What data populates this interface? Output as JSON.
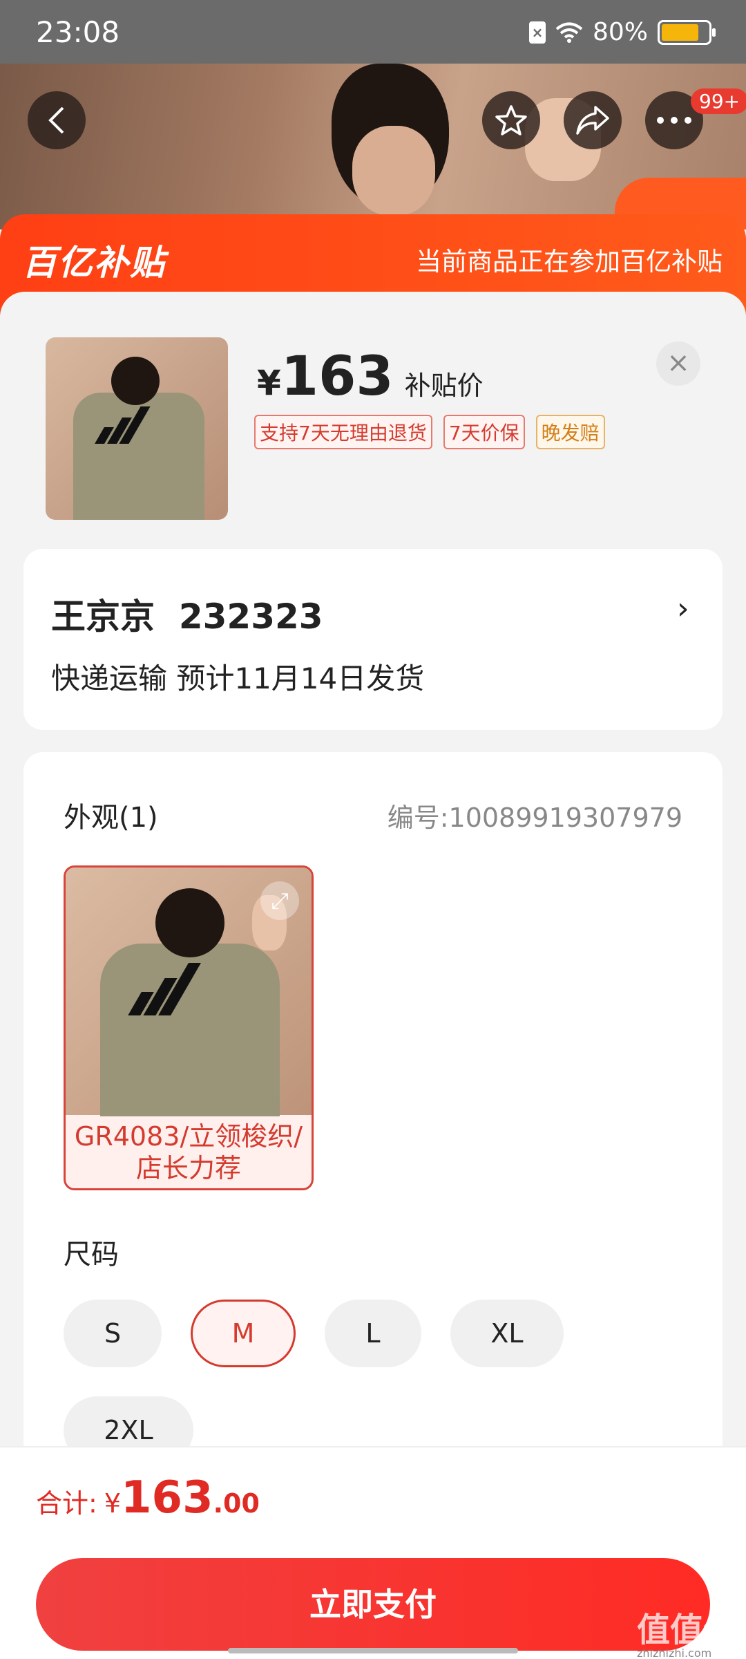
{
  "status_bar": {
    "time": "23:08",
    "battery": "80%"
  },
  "hero": {
    "more_badge": "99+"
  },
  "subsidy_banner": {
    "logo": "百亿补贴",
    "notice": "当前商品正在参加百亿补贴"
  },
  "product": {
    "currency": "¥",
    "price": "163",
    "price_label": "补贴价",
    "tags": [
      "支持7天无理由退货",
      "7天价保",
      "晚发赔"
    ]
  },
  "address": {
    "name": "王京京",
    "phone": "232323",
    "delivery": "快递运输 预计11月14日发货"
  },
  "appearance": {
    "title": "外观(1)",
    "code": "编号:10089919307979",
    "variant_caption": "GR4083/立领梭织/店长力荐"
  },
  "size": {
    "title": "尺码",
    "options": [
      "S",
      "M",
      "L",
      "XL",
      "2XL"
    ],
    "selected": "M"
  },
  "footer": {
    "total_label": "合计:",
    "currency": "¥",
    "total_int": "163",
    "total_dec": ".00",
    "pay_button": "立即支付",
    "watermark": "值值值",
    "watermark_site": "zhizhizhi.com"
  },
  "colors": {
    "accent": "#ff3f14",
    "price_red": "#e02a24",
    "selected": "#d43b2e"
  }
}
